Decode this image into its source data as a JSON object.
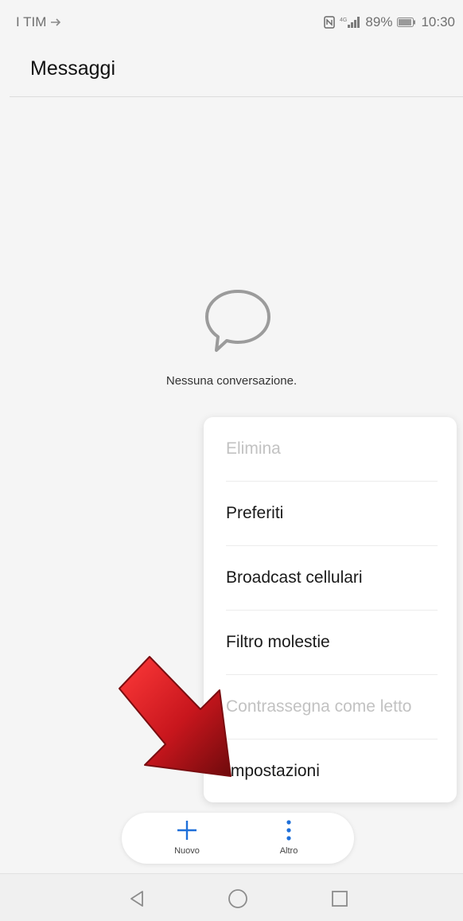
{
  "status_bar": {
    "carrier": "I TIM",
    "network": "4G",
    "battery": "89%",
    "time": "10:30"
  },
  "app_bar": {
    "title": "Messaggi"
  },
  "empty_state": {
    "icon": "chat-bubble-icon",
    "text": "Nessuna conversazione."
  },
  "menu": {
    "items": [
      {
        "label": "Elimina",
        "enabled": false
      },
      {
        "label": "Preferiti",
        "enabled": true
      },
      {
        "label": "Broadcast cellulari",
        "enabled": true
      },
      {
        "label": "Filtro molestie",
        "enabled": true
      },
      {
        "label": "Contrassegna come letto",
        "enabled": false
      },
      {
        "label": "Impostazioni",
        "enabled": true
      }
    ]
  },
  "actions": {
    "new_label": "Nuovo",
    "more_label": "Altro",
    "accent": "#1e6fd9"
  },
  "annotation": {
    "arrow_color": "#c8161d"
  },
  "nav": {
    "back": "back-triangle-icon",
    "home": "home-circle-icon",
    "recents": "recents-square-icon"
  }
}
